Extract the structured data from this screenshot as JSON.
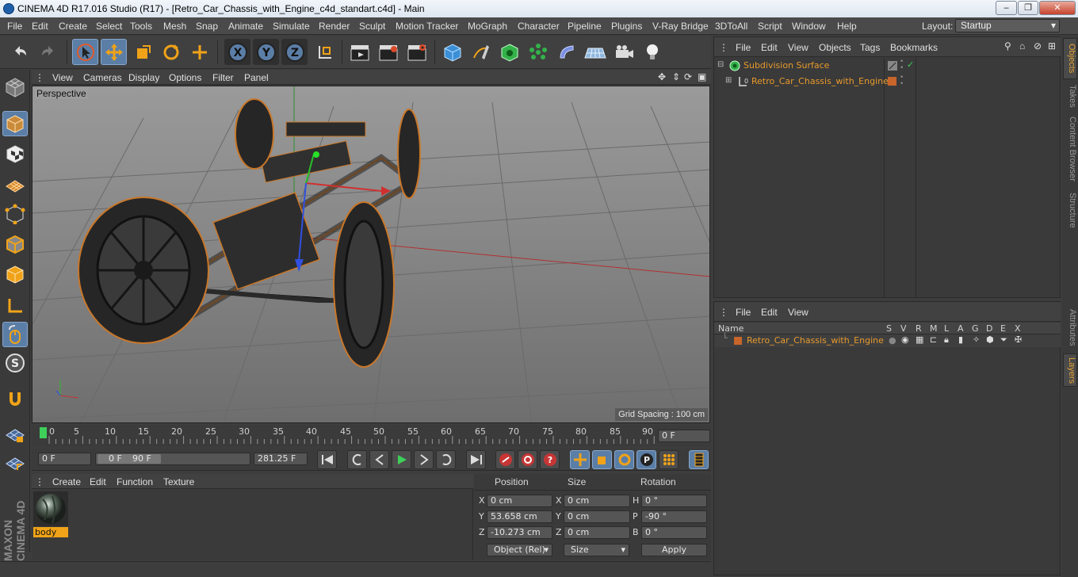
{
  "window": {
    "title": "CINEMA 4D R17.016 Studio (R17) - [Retro_Car_Chassis_with_Engine_c4d_standart.c4d] - Main",
    "minimize": "–",
    "maximize": "❐",
    "close": "✕"
  },
  "menu": {
    "items": [
      "File",
      "Edit",
      "Create",
      "Select",
      "Tools",
      "Mesh",
      "Snap",
      "Animate",
      "Simulate",
      "Render",
      "Sculpt",
      "Motion Tracker",
      "MoGraph",
      "Character",
      "Pipeline",
      "Plugins",
      "V-Ray Bridge",
      "3DToAll",
      "Script",
      "Window",
      "Help"
    ],
    "layout_label": "Layout:",
    "layout_value": "Startup"
  },
  "viewport": {
    "menu": [
      "View",
      "Cameras",
      "Display",
      "Options",
      "Filter",
      "Panel"
    ],
    "label": "Perspective",
    "grid_spacing": "Grid Spacing : 100 cm"
  },
  "timeline": {
    "ticks": [
      "0",
      "5",
      "10",
      "15",
      "20",
      "25",
      "30",
      "35",
      "40",
      "45",
      "50",
      "55",
      "60",
      "65",
      "70",
      "75",
      "80",
      "85",
      "90"
    ],
    "current_frame": "0 F"
  },
  "transport": {
    "start_field": "0 F",
    "range_start": "0 F",
    "range_end": "90 F",
    "end_field": "281.25 F"
  },
  "materials": {
    "menu": [
      "Create",
      "Edit",
      "Function",
      "Texture"
    ],
    "items": [
      {
        "name": "body"
      }
    ]
  },
  "coordinates": {
    "headers": [
      "Position",
      "Size",
      "Rotation"
    ],
    "position": {
      "x": "0 cm",
      "y": "53.658 cm",
      "z": "-10.273 cm"
    },
    "size": {
      "x": "0 cm",
      "y": "0 cm",
      "z": "0 cm"
    },
    "rotation": {
      "h": "0 °",
      "p": "-90 °",
      "b": "0 °"
    },
    "axis_labels": {
      "x": "X",
      "y": "Y",
      "z": "Z",
      "h": "H",
      "p": "P",
      "b": "B"
    },
    "mode_select": "Object (Rel)",
    "size_select": "Size",
    "apply": "Apply"
  },
  "objects": {
    "menu": [
      "File",
      "Edit",
      "View",
      "Objects",
      "Tags",
      "Bookmarks"
    ],
    "tree": [
      {
        "name": "Subdivision Surface",
        "color": "#e89a2c"
      },
      {
        "name": "Retro_Car_Chassis_with_Engine",
        "color": "#e89a2c"
      }
    ]
  },
  "layers": {
    "menu": [
      "File",
      "Edit",
      "View"
    ],
    "columns": [
      "Name",
      "S",
      "V",
      "R",
      "M",
      "L",
      "A",
      "G",
      "D",
      "E",
      "X"
    ],
    "rows": [
      {
        "name": "Retro_Car_Chassis_with_Engine",
        "color": "#c8652a"
      }
    ]
  },
  "right_tabs": [
    "Objects",
    "Takes",
    "Content Browser",
    "Structure",
    "Attributes",
    "Layers"
  ],
  "branding": "MAXON CINEMA 4D",
  "colors": {
    "accent": "#5b7ea6",
    "highlight": "#e89a2c"
  }
}
